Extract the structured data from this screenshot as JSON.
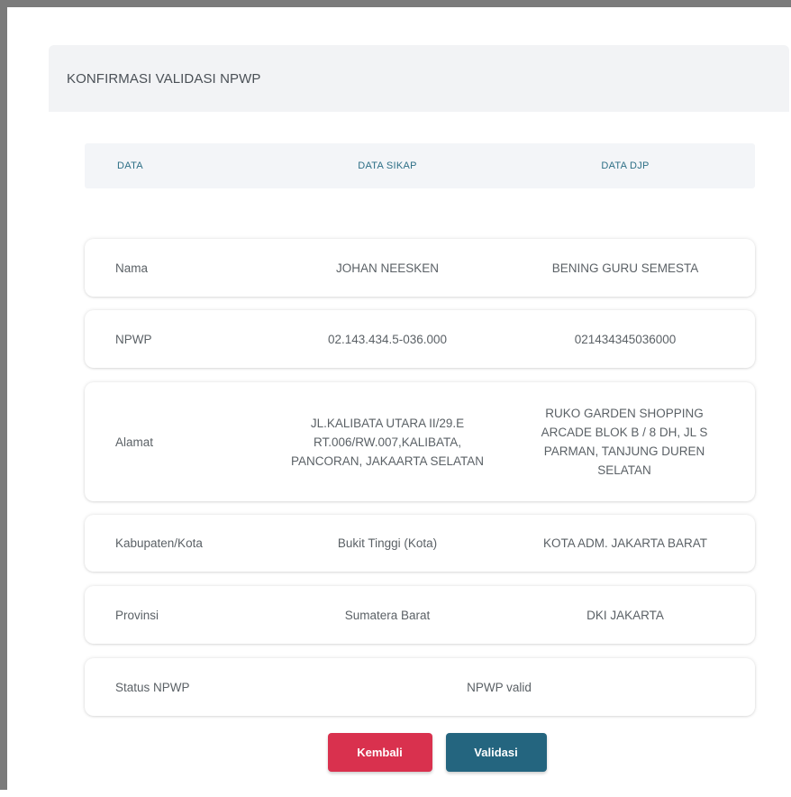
{
  "header": {
    "title": "KONFIRMASI VALIDASI NPWP"
  },
  "table": {
    "columns": [
      "DATA",
      "DATA SIKAP",
      "DATA DJP"
    ],
    "rows": [
      {
        "label": "Nama",
        "sikap": "JOHAN NEESKEN",
        "djp": "BENING GURU SEMESTA"
      },
      {
        "label": "NPWP",
        "sikap": "02.143.434.5-036.000",
        "djp": "021434345036000"
      },
      {
        "label": "Alamat",
        "sikap": "JL.KALIBATA UTARA II/29.E RT.006/RW.007,KALIBATA, PANCORAN, JAKAARTA SELATAN",
        "djp": "RUKO GARDEN SHOPPING ARCADE BLOK B / 8 DH, JL S PARMAN, TANJUNG DUREN SELATAN"
      },
      {
        "label": "Kabupaten/Kota",
        "sikap": "Bukit Tinggi (Kota)",
        "djp": "KOTA ADM. JAKARTA BARAT"
      },
      {
        "label": "Provinsi",
        "sikap": "Sumatera Barat",
        "djp": "DKI JAKARTA"
      }
    ],
    "status_row": {
      "label": "Status NPWP",
      "value": "NPWP valid"
    }
  },
  "actions": {
    "back_label": "Kembali",
    "validate_label": "Validasi"
  },
  "colors": {
    "header_bg": "#f2f3f5",
    "column_header_text": "#2d6f86",
    "back_button": "#d9314e",
    "validate_button": "#24657f"
  }
}
